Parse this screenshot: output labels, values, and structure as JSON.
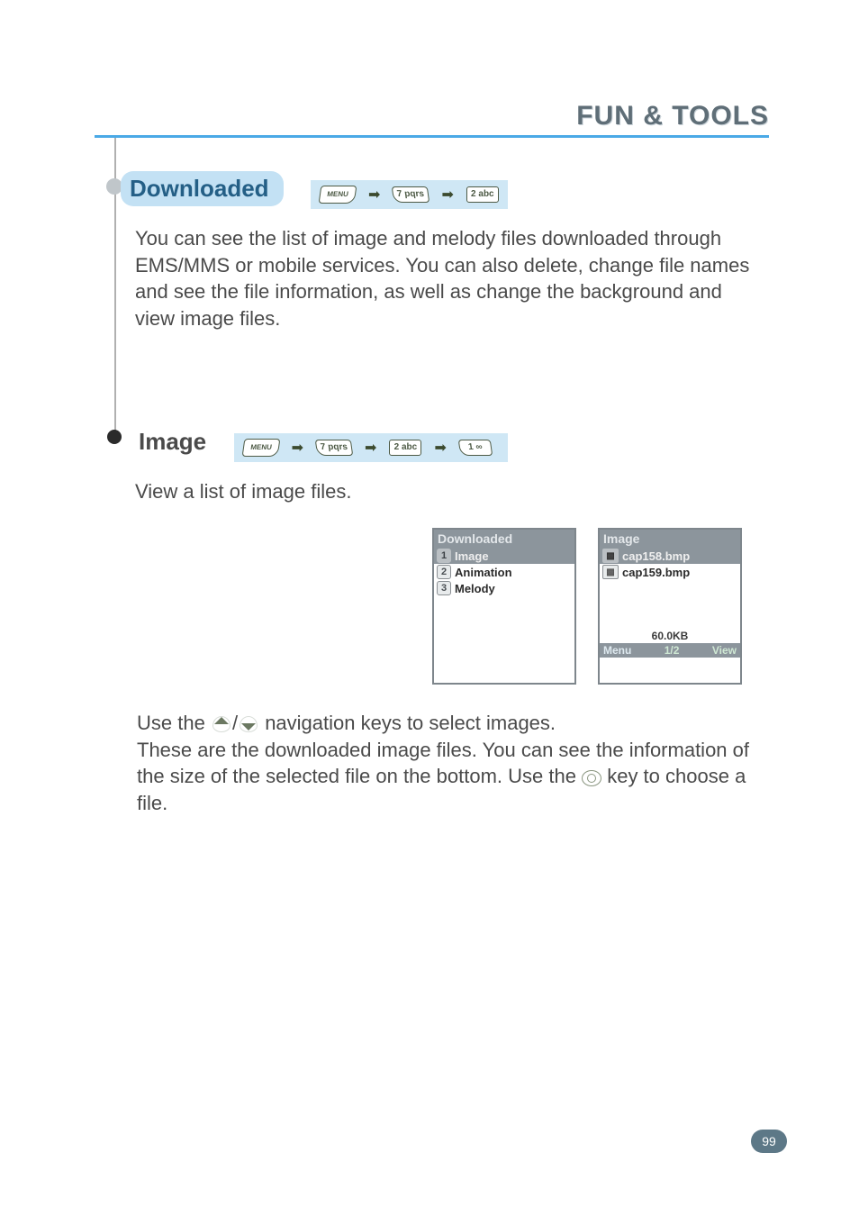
{
  "page": {
    "header_title": "FUN & TOOLS",
    "page_number": "99"
  },
  "downloaded": {
    "pill": "Downloaded",
    "path_keys": {
      "k1": "MENU",
      "k2": "7 pqrs",
      "k3": "2 abc"
    },
    "body": "You can see the list of image and melody files downloaded through EMS/MMS or mobile services. You can also delete, change file names and see the file information, as well as change the background and view image files."
  },
  "image": {
    "title": "Image",
    "path_keys": {
      "k1": "MENU",
      "k2": "7 pqrs",
      "k3": "2 abc",
      "k4": "1 ∞"
    },
    "body": "View a list of image files."
  },
  "screen_downloaded": {
    "title": "Downloaded",
    "rows": [
      {
        "num": "1",
        "label": "Image",
        "selected": true
      },
      {
        "num": "2",
        "label": "Animation",
        "selected": false
      },
      {
        "num": "3",
        "label": "Melody",
        "selected": false
      }
    ]
  },
  "screen_image": {
    "title": "Image",
    "rows": [
      {
        "label": "cap158.bmp",
        "selected": true
      },
      {
        "label": "cap159.bmp",
        "selected": false
      }
    ],
    "size": "60.0KB",
    "sk_left": "Menu",
    "sk_center": "1/2",
    "sk_right": "View"
  },
  "bottom": {
    "line1a": "Use the ",
    "line1b": " navigation keys to select images.",
    "line2a": "These are the downloaded image files. You can see the information of the size of the selected file on the bottom. Use the ",
    "line2b": " key to choose a file."
  }
}
